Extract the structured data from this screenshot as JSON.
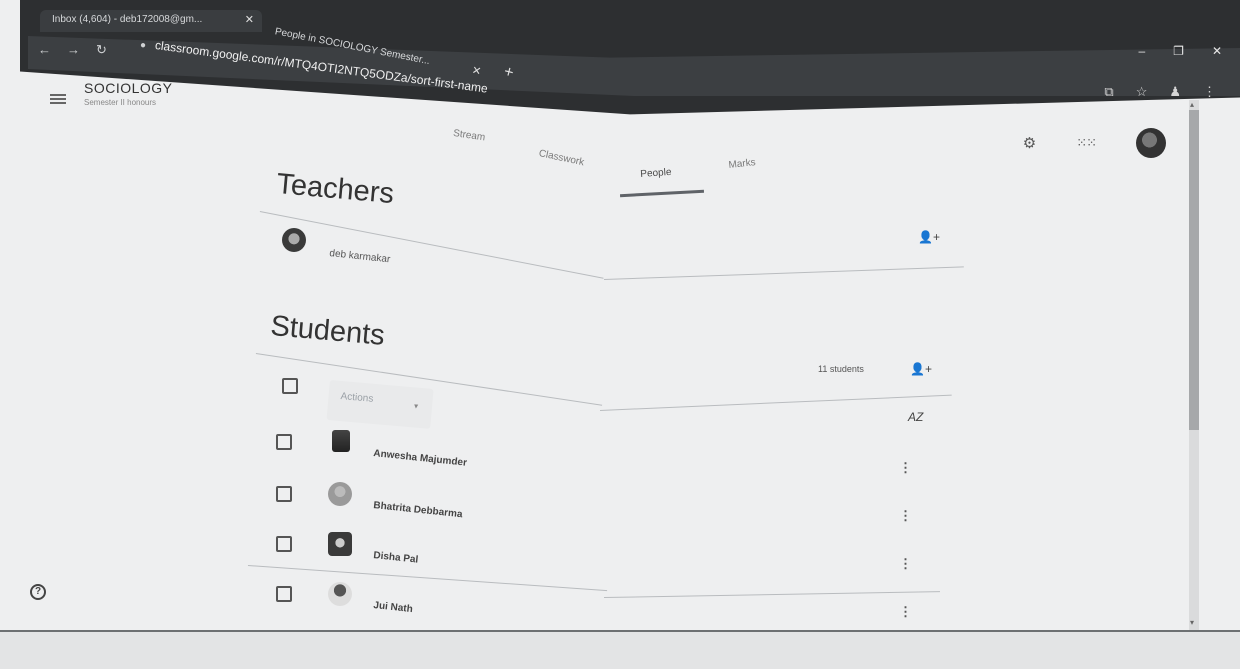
{
  "browser": {
    "tabs": [
      {
        "label": "Inbox (4,604) - deb172008@gm..."
      },
      {
        "label": "People in SOCIOLOGY Semester..."
      }
    ],
    "url": "classroom.google.com/r/MTQ4OTI2NTQ5ODZa/sort-first-name",
    "new_tab": "+"
  },
  "app": {
    "class_title": "SOCIOLOGY",
    "class_subtitle": "Semester II honours"
  },
  "nav": {
    "stream": "Stream",
    "classwork": "Classwork",
    "people": "People",
    "marks": "Marks"
  },
  "teachers": {
    "heading": "Teachers",
    "list": [
      {
        "name": "deb karmakar"
      }
    ]
  },
  "students": {
    "heading": "Students",
    "count": "11 students",
    "actions_label": "Actions",
    "list": [
      {
        "name": "Anwesha Majumder"
      },
      {
        "name": "Bhatrita Debbarma"
      },
      {
        "name": "Disha Pal"
      },
      {
        "name": "Jui Nath"
      }
    ]
  },
  "icons": {
    "settings": "gear-icon",
    "apps": "apps-grid-icon",
    "help": "help-icon"
  }
}
